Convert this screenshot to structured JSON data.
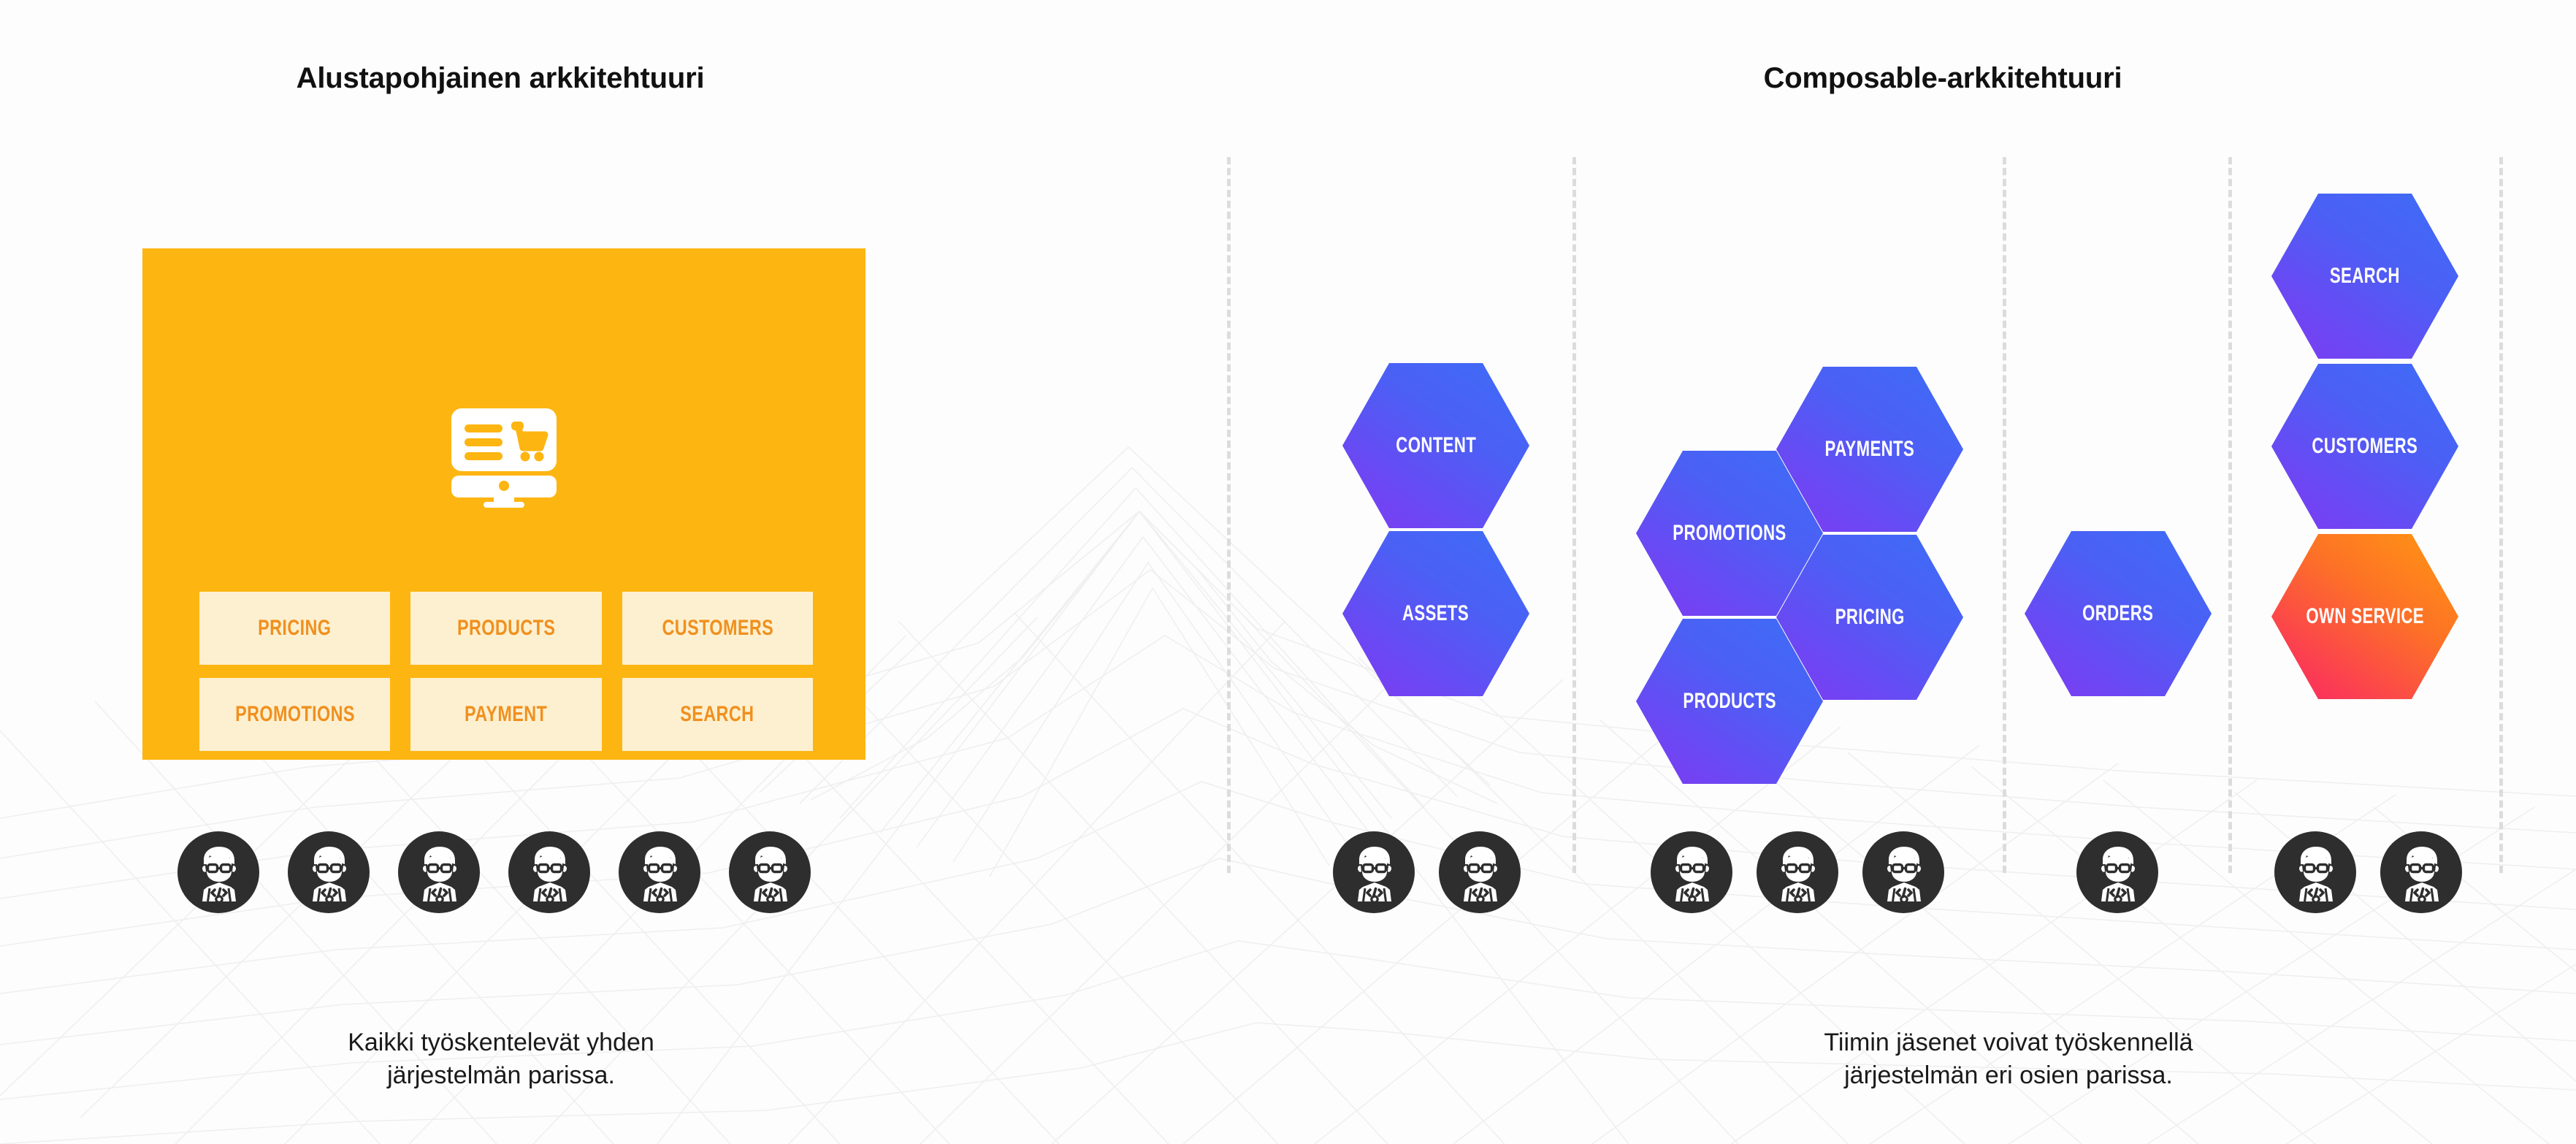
{
  "columns": {
    "left": {
      "title": "Alustapohjainen arkkitehtuuri"
    },
    "right": {
      "title": "Composable-arkkitehtuuri"
    }
  },
  "platform_panel": {
    "icon": "storefront-monitor-cart-icon",
    "background_color": "#FDB511",
    "chip_background_color": "#FDF0D0",
    "chip_text_color": "#F0901E",
    "modules": [
      {
        "label": "PRICING"
      },
      {
        "label": "PRODUCTS"
      },
      {
        "label": "CUSTOMERS"
      },
      {
        "label": "PROMOTIONS"
      },
      {
        "label": "PAYMENT"
      },
      {
        "label": "SEARCH"
      }
    ]
  },
  "composable": {
    "hex_gradient_blue": {
      "from": "#3D6DF6",
      "to": "#7E3BF2"
    },
    "hex_gradient_warm": {
      "from": "#FF9811",
      "to": "#FA2663"
    },
    "groups": [
      {
        "name": "content-assets",
        "hexes": [
          {
            "label": "CONTENT",
            "variant": "blue"
          },
          {
            "label": "ASSETS",
            "variant": "blue"
          }
        ],
        "avatar_count": 2
      },
      {
        "name": "catalog-commerce",
        "hexes": [
          {
            "label": "PROMOTIONS",
            "variant": "blue"
          },
          {
            "label": "PRODUCTS",
            "variant": "blue"
          },
          {
            "label": "PAYMENTS",
            "variant": "blue"
          },
          {
            "label": "PRICING",
            "variant": "blue"
          }
        ],
        "avatar_count": 3
      },
      {
        "name": "orders",
        "hexes": [
          {
            "label": "ORDERS",
            "variant": "blue"
          }
        ],
        "avatar_count": 1
      },
      {
        "name": "search-customers-own",
        "hexes": [
          {
            "label": "SEARCH",
            "variant": "blue"
          },
          {
            "label": "CUSTOMERS",
            "variant": "blue"
          },
          {
            "label": "OWN SERVICE",
            "variant": "warm"
          }
        ],
        "avatar_count": 2
      }
    ]
  },
  "avatars": {
    "icon": "developer-avatar-icon",
    "circle_color": "#2E2E2E",
    "left_count": 6
  },
  "captions": {
    "left": "Kaikki työskentelevät yhden\njärjestelmän parissa.",
    "right": "Tiimin jäsenet voivat työskennellä\njärjestelmän eri osien parissa."
  },
  "dividers": {
    "count": 5,
    "color": "#dcdcdc"
  }
}
